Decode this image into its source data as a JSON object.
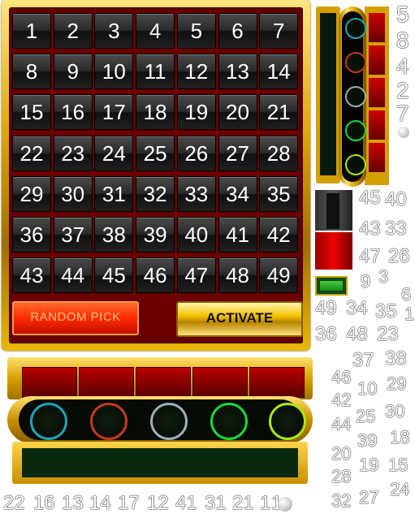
{
  "board": {
    "numbers": [
      1,
      2,
      3,
      4,
      5,
      6,
      7,
      8,
      9,
      10,
      11,
      12,
      13,
      14,
      15,
      16,
      17,
      18,
      19,
      20,
      21,
      22,
      23,
      24,
      25,
      26,
      27,
      28,
      29,
      30,
      31,
      32,
      33,
      34,
      35,
      36,
      37,
      38,
      39,
      40,
      41,
      42,
      43,
      44,
      45,
      46,
      47,
      48,
      49
    ],
    "random_pick_label": "RANDOM PICK",
    "activate_label": "ACTIVATE"
  },
  "colors": {
    "gold": "#e8b800",
    "board_red": "#6a0000",
    "random_button": "#ff2a00",
    "ball_rings": [
      "#1aa8b8",
      "#c83a1a",
      "#9ab0b8",
      "#1ad83a",
      "#a8e81a"
    ]
  },
  "sprite_numbers": {
    "col_top": [
      "5",
      "8",
      "4",
      "2",
      "7"
    ],
    "col_mid": [
      "45",
      "40",
      "43",
      "33",
      "47",
      "26",
      "3",
      "9",
      "6",
      "1"
    ],
    "row_a": [
      "49",
      "34",
      "35"
    ],
    "row_b": [
      "36",
      "48",
      "23",
      "1"
    ],
    "block_nums": [
      "37",
      "38",
      "46",
      "10",
      "29",
      "42",
      "30",
      "44",
      "25",
      "18",
      "39",
      "15",
      "20",
      "19",
      "24",
      "28",
      "32",
      "27"
    ],
    "bottom_row": [
      "22",
      "16",
      "13",
      "14",
      "17",
      "12",
      "41",
      "31",
      "21",
      "1",
      "1"
    ]
  }
}
